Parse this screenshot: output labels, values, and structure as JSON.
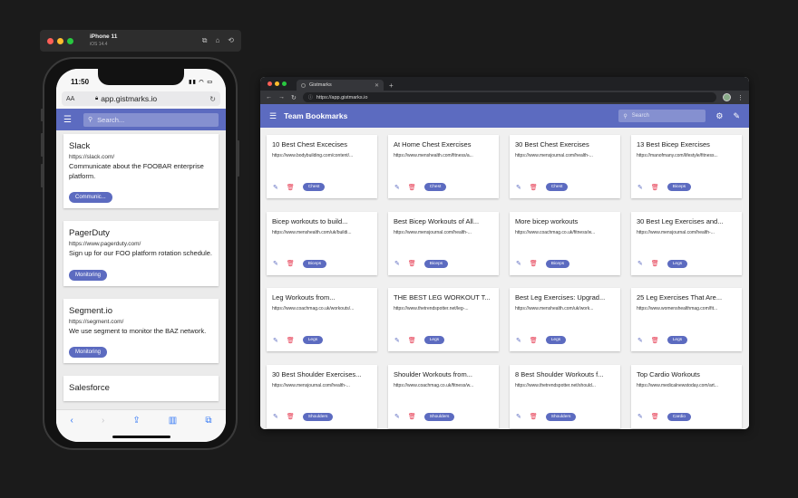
{
  "simulator": {
    "device": "iPhone 11",
    "os": "iOS 14.4",
    "icons": [
      "screenshot-icon",
      "home-icon",
      "rotate-icon"
    ]
  },
  "phone": {
    "time": "11:50",
    "text_size_label": "AA",
    "url": "app.gistmarks.io",
    "search_placeholder": "Search...",
    "bookmarks": [
      {
        "title": "Slack",
        "url": "https://slack.com/",
        "description": "Communicate about the FOOBAR enterprise platform.",
        "tag": "Communic..."
      },
      {
        "title": "PagerDuty",
        "url": "https://www.pagerduty.com/",
        "description": "Sign up for our FOO platform rotation schedule.",
        "tag": "Monitoring"
      },
      {
        "title": "Segment.io",
        "url": "https://segment.com/",
        "description": "We use segment to monitor the BAZ network.",
        "tag": "Monitoring"
      },
      {
        "title": "Salesforce",
        "url": "",
        "description": "",
        "tag": ""
      }
    ]
  },
  "browser": {
    "tab_title": "Gistmarks",
    "url": "https://app.gistmarks.io",
    "app_title": "Team Bookmarks",
    "search_placeholder": "Search",
    "accent": "#5c6bc0",
    "delete_color": "#e53950",
    "bookmarks": [
      {
        "title": "10 Best Chest Excecises",
        "url": "https://www.bodybuilding.com/content/...",
        "tag": "Chest"
      },
      {
        "title": "At Home Chest Exercises",
        "url": "https://www.menshealth.com/fitness/a...",
        "tag": "Chest"
      },
      {
        "title": "30 Best Chest Exercises",
        "url": "https://www.mensjournal.com/health-...",
        "tag": "Chest"
      },
      {
        "title": "13 Best Bicep Exercises",
        "url": "https://manofmany.com/lifestyle/fitness...",
        "tag": "Biceps"
      },
      {
        "title": "Bicep workouts to build...",
        "url": "https://www.menshealth.com/uk/buildi...",
        "tag": "Biceps"
      },
      {
        "title": "Best Bicep Workouts of All...",
        "url": "https://www.mensjournal.com/health-...",
        "tag": "Biceps"
      },
      {
        "title": "More bicep workouts",
        "url": "https://www.coachmag.co.uk/fitness/w...",
        "tag": "Biceps"
      },
      {
        "title": "30 Best Leg Exercises and...",
        "url": "https://www.mensjournal.com/health-...",
        "tag": "Legs"
      },
      {
        "title": "Leg Workouts from...",
        "url": "https://www.coachmag.co.uk/workouts/...",
        "tag": "Legs"
      },
      {
        "title": "THE BEST LEG WORKOUT T...",
        "url": "https://www.thetrendspotter.net/leg-...",
        "tag": "Legs"
      },
      {
        "title": "Best Leg Exercises: Upgrad...",
        "url": "https://www.menshealth.com/uk/work...",
        "tag": "Legs"
      },
      {
        "title": "25 Leg Exercises That Are...",
        "url": "https://www.womenshealthmag.com/fit...",
        "tag": "Legs"
      },
      {
        "title": "30 Best Shoulder Exercises...",
        "url": "https://www.mensjournal.com/health-...",
        "tag": "Shoulders"
      },
      {
        "title": "Shoulder Workouts from...",
        "url": "https://www.coachmag.co.uk/fitness/w...",
        "tag": "Shoulders"
      },
      {
        "title": "8 Best Shoulder Workouts f...",
        "url": "https://www.thetrendspotter.net/should...",
        "tag": "Shoulders"
      },
      {
        "title": "Top Cardio Workouts",
        "url": "https://www.medicalnewstoday.com/art...",
        "tag": "Cardio"
      }
    ]
  }
}
